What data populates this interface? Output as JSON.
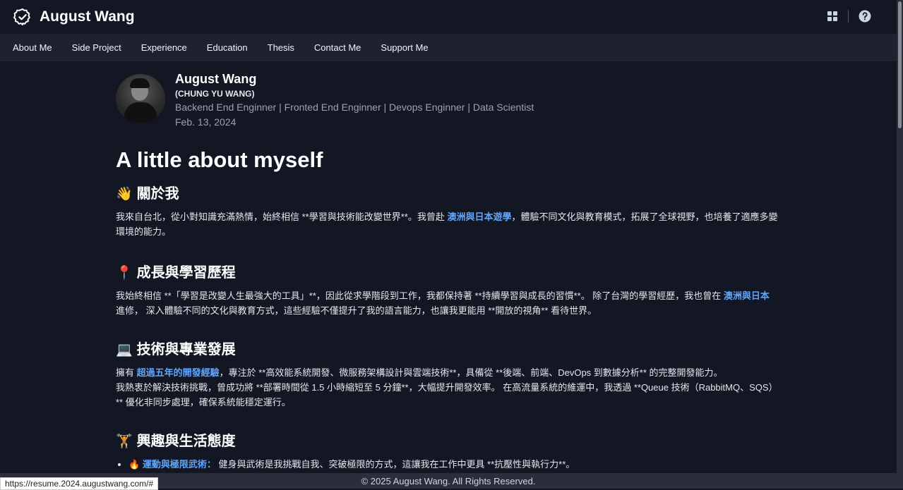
{
  "header": {
    "title": "August Wang",
    "logo_icon": "verified-badge-icon",
    "actions": [
      "grid-apps-icon",
      "help-icon"
    ]
  },
  "nav": {
    "items": [
      "About Me",
      "Side Project",
      "Experience",
      "Education",
      "Thesis",
      "Contact Me",
      "Support Me"
    ]
  },
  "profile": {
    "name": "August Wang",
    "subname": "(CHUNG YU WANG)",
    "roles": "Backend End Enginner | Fronted End Enginner | Devops Enginner | Data Scientist",
    "date": "Feb. 13, 2024"
  },
  "page_heading": "A little about myself",
  "sections": [
    {
      "emoji": "👋",
      "title": "關於我",
      "text_a": "我來自台北，從小對知識充滿熱情，始終相信 **學習與技術能改變世界**。我曾赴 ",
      "link": "澳洲與日本遊學",
      "text_b": "，體驗不同文化與教育模式，拓展了全球視野，也培養了適應多變環境的能力。"
    },
    {
      "emoji": "📍",
      "title": "成長與學習歷程",
      "text_a": "我始終相信 **「學習是改變人生最強大的工具」**，因此從求學階段到工作，我都保持著 **持續學習與成長的習慣**。 除了台灣的學習經歷，我也曾在 ",
      "link": "澳洲與日本",
      "text_b": " 進修， 深入體驗不同的文化與教育方式，這些經驗不僅提升了我的語言能力，也讓我更能用 **開放的視角** 看待世界。"
    },
    {
      "emoji": "💻",
      "title": "技術與專業發展",
      "text_a": "擁有 ",
      "link": "超過五年的開發經驗",
      "text_b": "，專注於 **高效能系統開發、微服務架構設計與雲端技術**，具備從 **後端、前端、DevOps 到數據分析** 的完整開發能力。",
      "text_c": "我熱衷於解決技術挑戰，曾成功將 **部署時間從 1.5 小時縮短至 5 分鐘**，大幅提升開發效率。 在高流量系統的維運中，我透過 **Queue 技術（RabbitMQ、SQS）** 優化非同步處理，確保系統能穩定運行。"
    },
    {
      "emoji": "🏋",
      "title": "興趣與生活態度",
      "list_emoji": "🔥",
      "list_link": "運動與極限武術：",
      "list_text": " 健身與武術是我挑戰自我、突破極限的方式，這讓我在工作中更具 **抗壓性與執行力**。"
    }
  ],
  "footer": "© 2025 August Wang. All Rights Reserved.",
  "status_url": "https://resume.2024.augustwang.com/#"
}
